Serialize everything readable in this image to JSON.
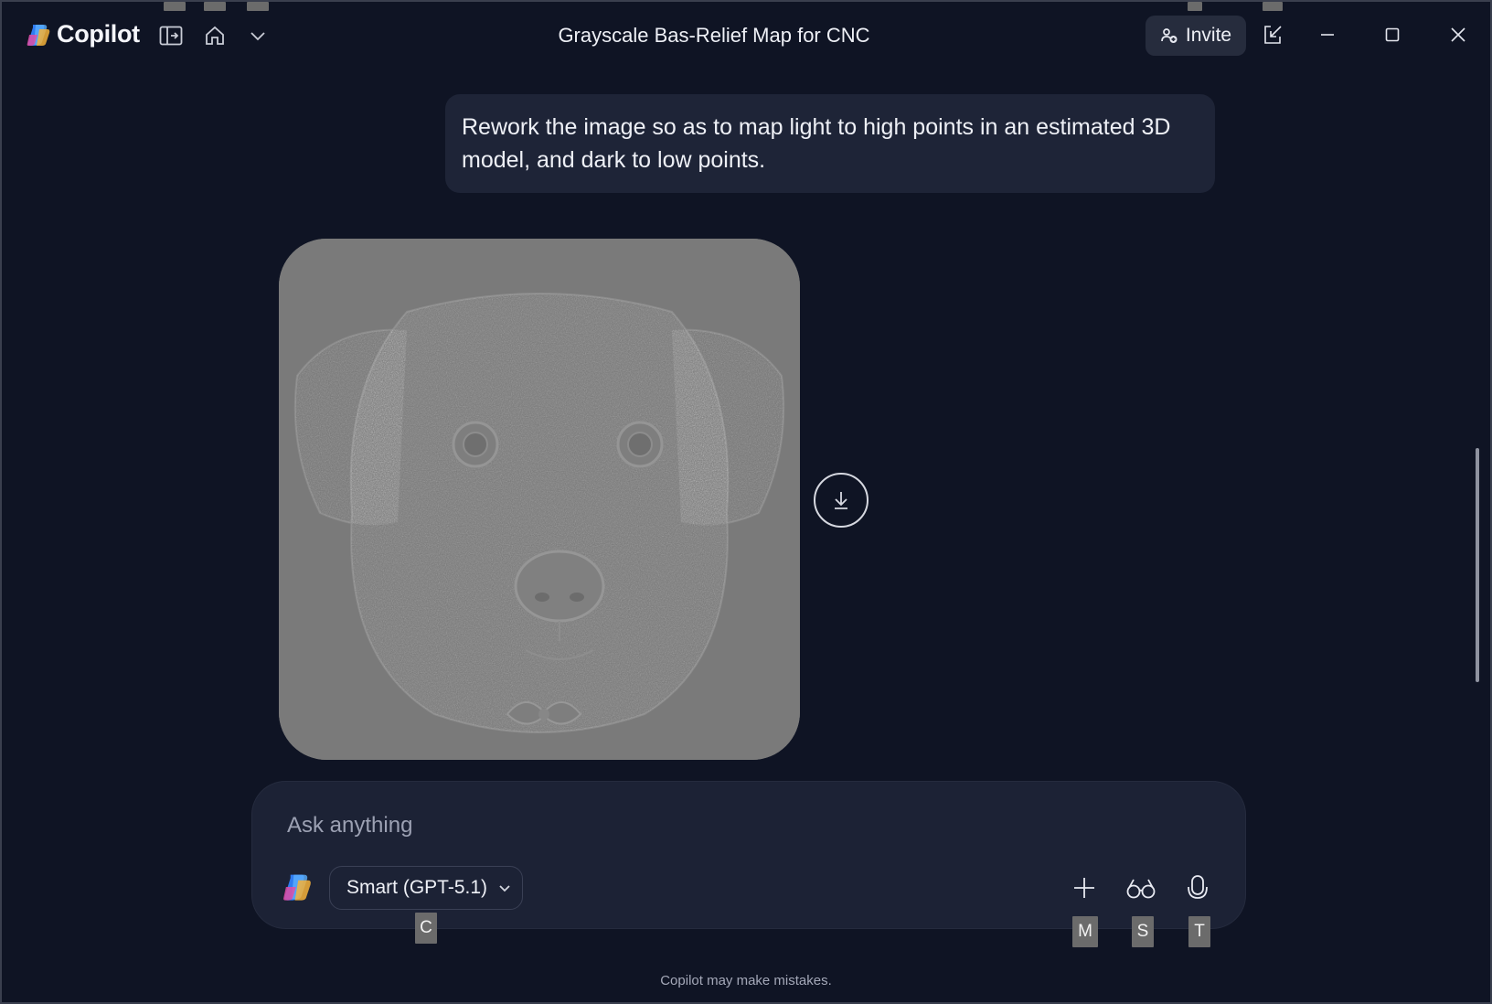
{
  "app": {
    "name": "Copilot",
    "title": "Grayscale Bas-Relief Map for CNC"
  },
  "titlebar": {
    "invite_label": "Invite",
    "icons": [
      "sidebar-toggle-icon",
      "home-icon",
      "chevron-down-icon",
      "share-out-icon",
      "minimize-icon",
      "maximize-icon",
      "close-icon"
    ]
  },
  "conversation": {
    "user_message": "Rework the image so as to map light to high points in an estimated 3D model, and dark to low points."
  },
  "composer": {
    "placeholder": "Ask anything",
    "model_label": "Smart (GPT-5.1)"
  },
  "keytips": {
    "model": "C",
    "add": "M",
    "vision": "S",
    "voice": "T"
  },
  "footer": {
    "disclaimer": "Copilot may make mistakes."
  },
  "colors": {
    "background": "#0f1424",
    "bubble": "#1e2437",
    "composer": "#1c2235",
    "image_gray": "#7a7a7a"
  }
}
